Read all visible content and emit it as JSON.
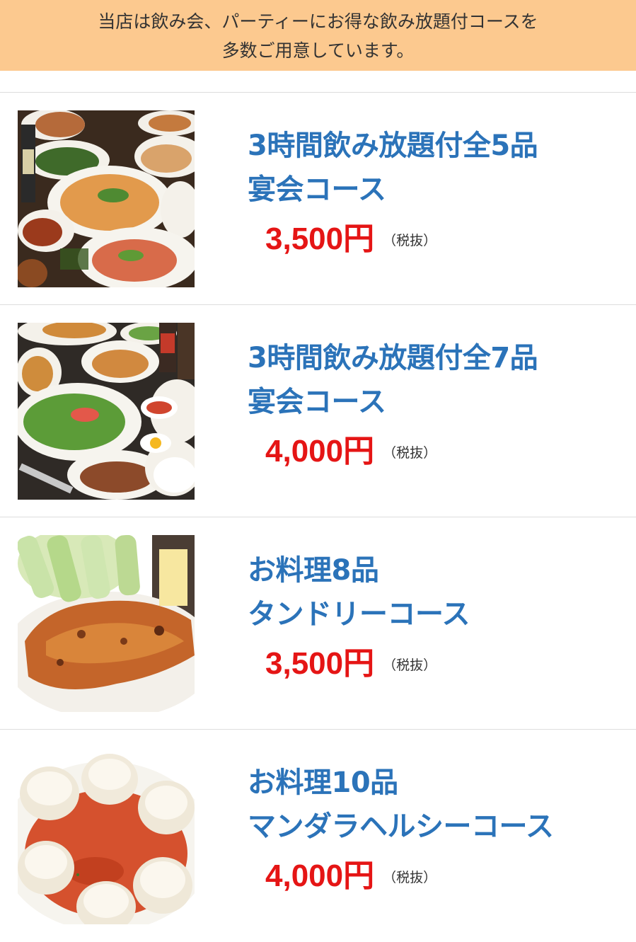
{
  "banner": {
    "line1": "当店は飲み会、パーティーにお得な飲み放題付コースを",
    "line2": "多数ご用意しています。"
  },
  "courses": [
    {
      "title1": "3時間飲み放題付全5品",
      "title2": "宴会コース",
      "price": "3,500円",
      "tax": "（税抜）",
      "image": "pad-thai-banquet-photo"
    },
    {
      "title1": "3時間飲み放題付全7品",
      "title2": "宴会コース",
      "price": "4,000円",
      "tax": "（税抜）",
      "image": "curry-salad-banquet-photo"
    },
    {
      "title1": "お料理8品",
      "title2": "タンドリーコース",
      "price": "3,500円",
      "tax": "（税抜）",
      "image": "tandoori-chicken-photo"
    },
    {
      "title1": "お料理10品",
      "title2": "マンダラヘルシーコース",
      "price": "4,000円",
      "tax": "（税抜）",
      "image": "momo-dumplings-photo"
    }
  ],
  "colors": {
    "banner": "#fcc98f",
    "title": "#2b73b9",
    "price": "#e51515",
    "divider": "#dddddd"
  }
}
